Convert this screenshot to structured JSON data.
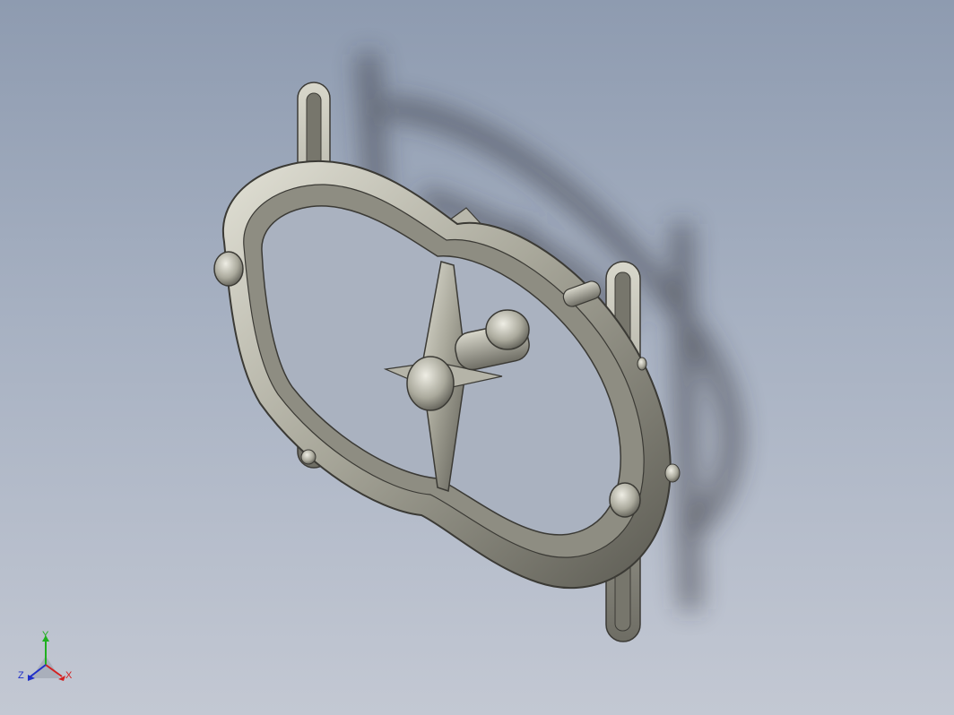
{
  "viewport": {
    "background_top": "#8e9bb0",
    "background_bottom": "#c3c8d3",
    "model_color": "#a8a79b"
  },
  "triad": {
    "x_label": "X",
    "y_label": "Y",
    "z_label": "Z",
    "x_color": "#d42020",
    "y_color": "#20b020",
    "z_color": "#2030c8"
  }
}
